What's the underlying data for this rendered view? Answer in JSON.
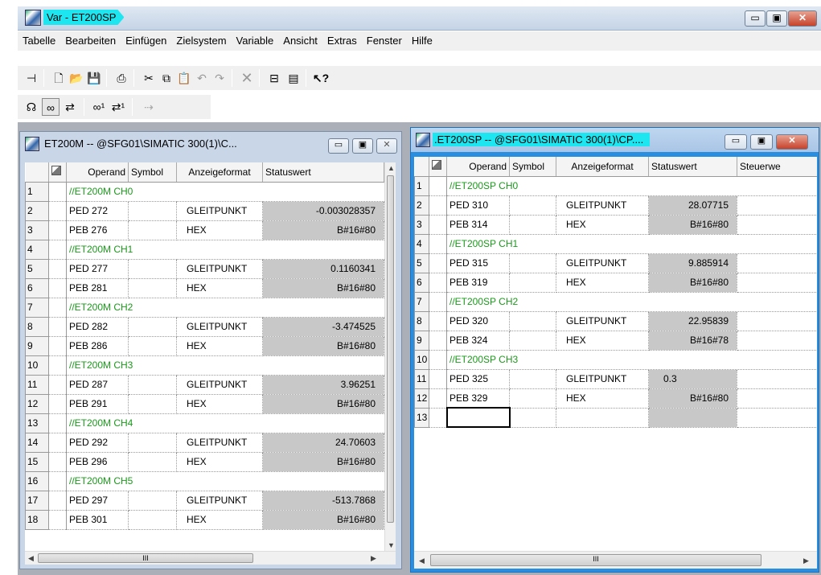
{
  "app": {
    "title": "Var - ET200SP"
  },
  "menu": [
    "Tabelle",
    "Bearbeiten",
    "Einfügen",
    "Zielsystem",
    "Variable",
    "Ansicht",
    "Extras",
    "Fenster",
    "Hilfe"
  ],
  "toolbar1": [
    "pin-icon",
    "new-icon",
    "open-icon",
    "save-icon",
    "print-icon",
    "cut-icon",
    "copy-icon",
    "paste-icon",
    "undo-icon",
    "redo-icon",
    "delete-icon",
    "online-icon",
    "module-info-icon",
    "help-icon"
  ],
  "toolbar2": [
    "monitor-icon",
    "monitor-glasses-icon",
    "modify-icon",
    "monitor-once-icon",
    "modify-once-icon",
    "force-icon"
  ],
  "left": {
    "title": "ET200M -- @SFG01\\SIMATIC 300(1)\\C...",
    "headers": [
      "Operand",
      "Symbol",
      "Anzeigeformat",
      "Statuswert"
    ],
    "rows": [
      {
        "n": "1",
        "comment": "//ET200M CH0"
      },
      {
        "n": "2",
        "operand": "PED  272",
        "symbol": "",
        "format": "GLEITPUNKT",
        "status": "-0.003028357"
      },
      {
        "n": "3",
        "operand": "PEB  276",
        "symbol": "",
        "format": "HEX",
        "status": "B#16#80"
      },
      {
        "n": "4",
        "comment": "//ET200M CH1"
      },
      {
        "n": "5",
        "operand": "PED  277",
        "symbol": "",
        "format": "GLEITPUNKT",
        "status": "0.1160341"
      },
      {
        "n": "6",
        "operand": "PEB  281",
        "symbol": "",
        "format": "HEX",
        "status": "B#16#80"
      },
      {
        "n": "7",
        "comment": "//ET200M CH2"
      },
      {
        "n": "8",
        "operand": "PED  282",
        "symbol": "",
        "format": "GLEITPUNKT",
        "status": "-3.474525"
      },
      {
        "n": "9",
        "operand": "PEB  286",
        "symbol": "",
        "format": "HEX",
        "status": "B#16#80"
      },
      {
        "n": "10",
        "comment": "//ET200M CH3"
      },
      {
        "n": "11",
        "operand": "PED  287",
        "symbol": "",
        "format": "GLEITPUNKT",
        "status": "3.96251"
      },
      {
        "n": "12",
        "operand": "PEB  291",
        "symbol": "",
        "format": "HEX",
        "status": "B#16#80"
      },
      {
        "n": "13",
        "comment": "//ET200M CH4"
      },
      {
        "n": "14",
        "operand": "PED  292",
        "symbol": "",
        "format": "GLEITPUNKT",
        "status": "24.70603"
      },
      {
        "n": "15",
        "operand": "PEB  296",
        "symbol": "",
        "format": "HEX",
        "status": "B#16#80"
      },
      {
        "n": "16",
        "comment": "//ET200M CH5"
      },
      {
        "n": "17",
        "operand": "PED  297",
        "symbol": "",
        "format": "GLEITPUNKT",
        "status": "-513.7868"
      },
      {
        "n": "18",
        "operand": "PEB  301",
        "symbol": "",
        "format": "HEX",
        "status": "B#16#80"
      }
    ]
  },
  "right": {
    "title": ".ET200SP -- @SFG01\\SIMATIC 300(1)\\CP....",
    "headers": [
      "Operand",
      "Symbol",
      "Anzeigeformat",
      "Statuswert",
      "Steuerwe"
    ],
    "rows": [
      {
        "n": "1",
        "comment": "//ET200SP CH0"
      },
      {
        "n": "2",
        "operand": "PED  310",
        "symbol": "",
        "format": "GLEITPUNKT",
        "status": "28.07715"
      },
      {
        "n": "3",
        "operand": "PEB  314",
        "symbol": "",
        "format": "HEX",
        "status": "B#16#80"
      },
      {
        "n": "4",
        "comment": "//ET200SP CH1"
      },
      {
        "n": "5",
        "operand": "PED  315",
        "symbol": "",
        "format": "GLEITPUNKT",
        "status": "9.885914"
      },
      {
        "n": "6",
        "operand": "PEB  319",
        "symbol": "",
        "format": "HEX",
        "status": "B#16#80"
      },
      {
        "n": "7",
        "comment": "//ET200SP CH2"
      },
      {
        "n": "8",
        "operand": "PED  320",
        "symbol": "",
        "format": "GLEITPUNKT",
        "status": "22.95839"
      },
      {
        "n": "9",
        "operand": "PEB  324",
        "symbol": "",
        "format": "HEX",
        "status": "B#16#78"
      },
      {
        "n": "10",
        "comment": "//ET200SP CH3"
      },
      {
        "n": "11",
        "operand": "PED  325",
        "symbol": "",
        "format": "GLEITPUNKT",
        "status": "0.3",
        "left_align": true
      },
      {
        "n": "12",
        "operand": "PEB  329",
        "symbol": "",
        "format": "HEX",
        "status": "B#16#80"
      },
      {
        "n": "13",
        "operand": "",
        "symbol": "",
        "format": "",
        "status": "",
        "editing": true
      }
    ]
  }
}
